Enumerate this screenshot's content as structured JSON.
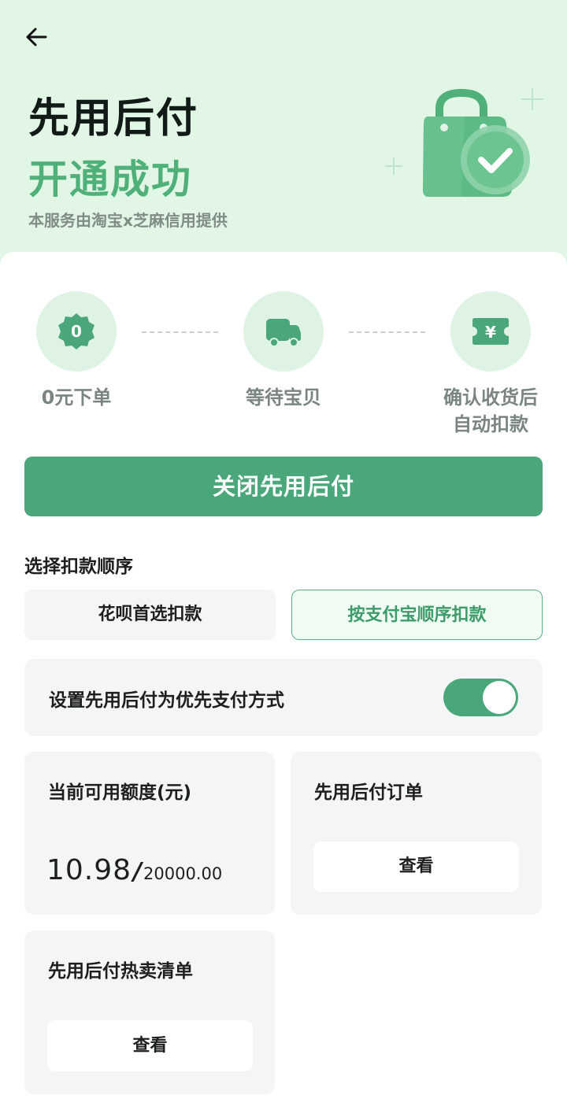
{
  "header": {
    "title": "先用后付",
    "subtitle": "开通成功",
    "provider_note": "本服务由淘宝x芝麻信用提供"
  },
  "steps": [
    {
      "icon": "zero-badge-icon",
      "badge_text": "0",
      "label": "0元下单"
    },
    {
      "icon": "truck-icon",
      "label": "等待宝贝"
    },
    {
      "icon": "yuan-ticket-icon",
      "badge_text": "¥",
      "label_line1": "确认收货后",
      "label_line2": "自动扣款"
    }
  ],
  "actions": {
    "close_label": "关闭先用后付"
  },
  "deduction_order": {
    "title": "选择扣款顺序",
    "options": [
      {
        "label": "花呗首选扣款",
        "selected": false
      },
      {
        "label": "按支付宝顺序扣款",
        "selected": true
      }
    ]
  },
  "preferred_payment": {
    "label": "设置先用后付为优先支付方式",
    "enabled": true
  },
  "quota": {
    "title": "当前可用额度(元)",
    "current": "10.98",
    "separator": "/",
    "total": "20000.00"
  },
  "orders": {
    "title": "先用后付订单",
    "button": "查看"
  },
  "hot_list": {
    "title": "先用后付热卖清单",
    "button": "查看"
  },
  "colors": {
    "accent": "#4aa77a",
    "hero_bg": "#e2f6e6",
    "tile_bg": "#f4f5f7"
  }
}
